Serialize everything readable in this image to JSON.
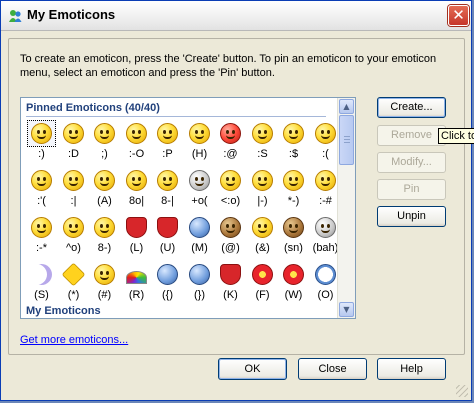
{
  "window": {
    "title": "My Emoticons",
    "close_symbol": "✕",
    "title_icon": "msn-buddy-icon"
  },
  "instructions": "To create an emoticon, press the 'Create' button.  To pin an emoticon to your emoticon menu, select an emoticon and press the 'Pin' button.",
  "list": {
    "pinned_title": "Pinned Emoticons (40/40)",
    "my_title": "My Emoticons",
    "rows": [
      [
        ":)",
        ":D",
        ";)",
        ":-O",
        ":P",
        "(H)",
        ":@",
        ":S",
        ":$",
        ":("
      ],
      [
        ":'(",
        ":|",
        "(A)",
        "8o|",
        "8-|",
        "+o(",
        "<:o)",
        "|-)",
        "*-)",
        ":-#"
      ],
      [
        ":-*",
        "^o)",
        "8-)",
        "(L)",
        "(U)",
        "(M)",
        "(@)",
        "(&)",
        "(sn)",
        "(bah)"
      ],
      [
        "(S)",
        "(*)",
        "(#)",
        "(R)",
        "({)",
        "(})",
        "(K)",
        "(F)",
        "(W)",
        "(O)"
      ]
    ],
    "icons": [
      [
        "smile-icon",
        "big-grin-icon",
        "wink-icon",
        "surprised-icon",
        "tongue-icon",
        "hot-sunglasses-icon",
        "angry-icon",
        "confused-icon",
        "embarrassed-icon",
        "sad-icon"
      ],
      [
        "crying-icon",
        "disappointed-icon",
        "angel-icon",
        "baring-teeth-icon",
        "nerd-icon",
        "sick-icon",
        "party-icon",
        "sleepy-icon",
        "thinking-icon",
        "dont-tell-icon"
      ],
      [
        "secret-icon",
        "sarcastic-icon",
        "eye-roll-icon",
        "red-heart-icon",
        "broken-heart-icon",
        "messenger-icon",
        "dog-face-icon",
        "cat-face-icon",
        "snail-icon",
        "black-sheep-icon"
      ],
      [
        "sleeping-moon-icon",
        "star-icon",
        "sun-icon",
        "rainbow-icon",
        "left-hug-icon",
        "right-hug-icon",
        "red-lips-icon",
        "red-rose-icon",
        "wilted-rose-icon",
        "clock-icon"
      ]
    ]
  },
  "buttons": {
    "create": "Create...",
    "remove": "Remove",
    "modify": "Modify...",
    "pin": "Pin",
    "unpin": "Unpin",
    "ok": "OK",
    "close": "Close",
    "help": "Help"
  },
  "tooltip": "Click to",
  "link": "Get more emoticons...",
  "scroll": {
    "up": "▲",
    "down": "▼"
  }
}
